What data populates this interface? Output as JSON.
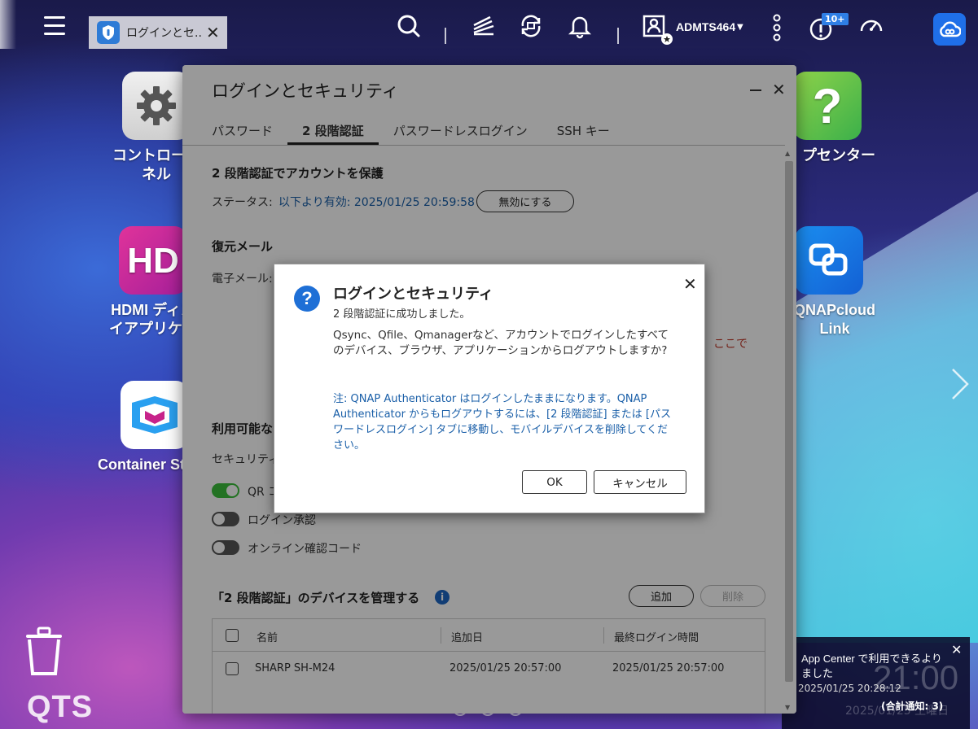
{
  "taskbar": {
    "tab_label": "ログインとセ...",
    "user_name": "ADMTS464",
    "notification_badge": "10+"
  },
  "desktop_apps": [
    {
      "name": "コントロールパネル",
      "line1": "コントロール",
      "line2": "ネル"
    },
    {
      "name": "HDMIディスプレイアプリケーション",
      "line1": "HDMI ディス",
      "line2": "イアプリケー"
    },
    {
      "name": "Container Station",
      "line1": "Container Sta",
      "line2": ""
    },
    {
      "name": "ヘルプセンター",
      "line1": "プセンター",
      "line2": ""
    },
    {
      "name": "QNAPcloud Link",
      "line1": "QNAPcloud",
      "line2": "Link"
    }
  ],
  "desktop": {
    "logo": "QTS"
  },
  "notification": {
    "message": "App Center で利用できるよりました",
    "time": "2025/01/25 20:28:12",
    "count": "(合計通知: 3)",
    "clock": "21:00",
    "date": "2025/01/25 土曜日"
  },
  "window": {
    "title": "ログインとセキュリティ",
    "tabs": [
      "パスワード",
      "2 段階認証",
      "パスワードレスログイン",
      "SSH キー"
    ],
    "section_protect": "2 段階認証でアカウントを保護",
    "status_label": "ステータス:",
    "status_value": "以下より有効: 2025/01/25 20:59:58",
    "disable_button": "無効にする",
    "section_recovery": "復元メール",
    "email_label": "電子メール:",
    "red_link_fragment": "ここで",
    "section_methods": "利用可能な",
    "security_label": "セキュリティ",
    "toggles": [
      {
        "label": "QR コ",
        "on": true
      },
      {
        "label": "ログイン承認",
        "on": false
      },
      {
        "label": "オンライン確認コード",
        "on": false
      }
    ],
    "section_devices": "「2 段階認証」のデバイスを管理する",
    "add_button": "追加",
    "delete_button": "削除",
    "table": {
      "columns": [
        "名前",
        "追加日",
        "最終ログイン時間"
      ],
      "rows": [
        [
          "SHARP SH-M24",
          "2025/01/25 20:57:00",
          "2025/01/25 20:57:00"
        ]
      ]
    }
  },
  "dialog": {
    "title": "ログインとセキュリティ",
    "subtitle": "2 段階認証に成功しました。",
    "body": "Qsync、Qfile、Qmanagerなど、アカウントでログインしたすべてのデバイス、ブラウザ、アプリケーションからログアウトしますか?",
    "note": "注: QNAP Authenticator はログインしたままになります。QNAP Authenticator からもログアウトするには、[2 段階認証] または [パスワードレスログイン] タブに移動し、モバイルデバイスを削除してください。",
    "ok_button": "OK",
    "cancel_button": "キャンセル"
  }
}
